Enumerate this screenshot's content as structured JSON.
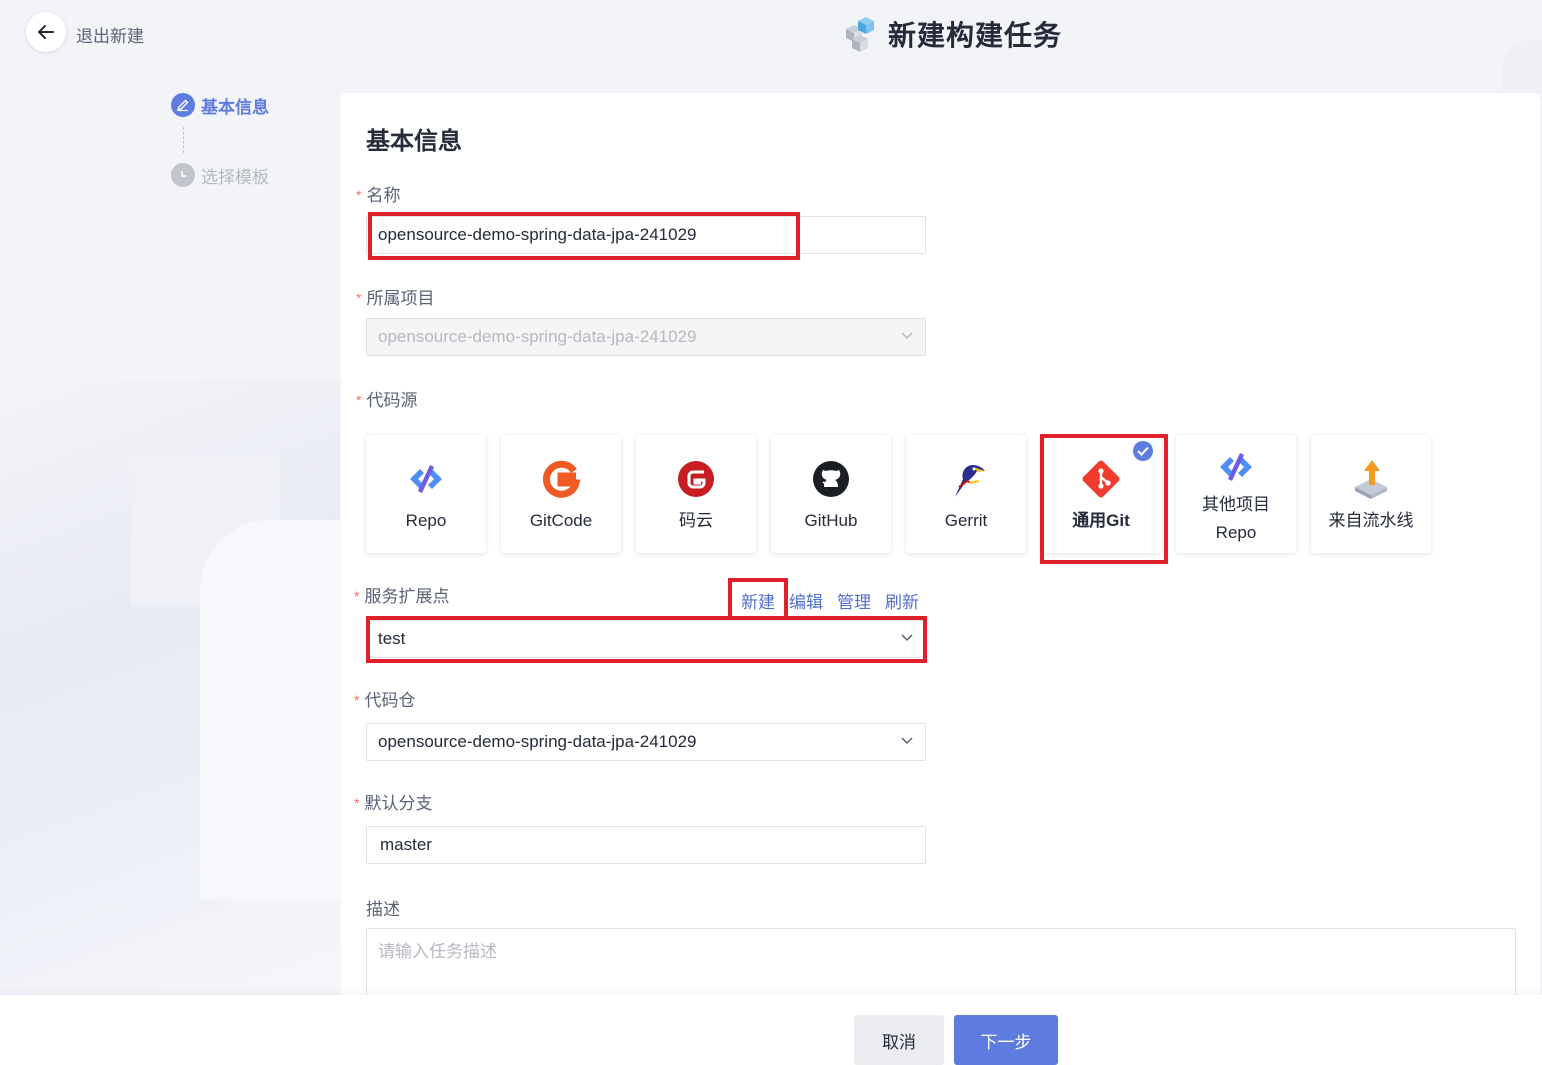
{
  "header": {
    "back_label": "退出新建",
    "page_title": "新建构建任务"
  },
  "steps": [
    {
      "label": "基本信息",
      "state": "active"
    },
    {
      "label": "选择模板",
      "state": "inactive"
    }
  ],
  "form": {
    "section_title": "基本信息",
    "name": {
      "label": "名称",
      "value": "opensource-demo-spring-data-jpa-241029"
    },
    "project": {
      "label": "所属项目",
      "value": "opensource-demo-spring-data-jpa-241029"
    },
    "code_source": {
      "label": "代码源",
      "options": [
        {
          "name": "Repo",
          "icon": "repo-icon"
        },
        {
          "name": "GitCode",
          "icon": "gitcode-icon"
        },
        {
          "name": "码云",
          "icon": "gitee-icon"
        },
        {
          "name": "GitHub",
          "icon": "github-icon"
        },
        {
          "name": "Gerrit",
          "icon": "gerrit-icon"
        },
        {
          "name": "通用Git",
          "icon": "git-icon",
          "selected": true
        },
        {
          "name": "其他项目Repo",
          "name_line1": "其他项目",
          "name_line2": "Repo",
          "icon": "repo-icon"
        },
        {
          "name": "来自流水线",
          "icon": "pipeline-icon"
        }
      ]
    },
    "endpoint": {
      "label": "服务扩展点",
      "value": "test",
      "links": {
        "new": "新建",
        "edit": "编辑",
        "manage": "管理",
        "refresh": "刷新"
      }
    },
    "repo": {
      "label": "代码仓",
      "value": "opensource-demo-spring-data-jpa-241029"
    },
    "branch": {
      "label": "默认分支",
      "value": "master"
    },
    "description": {
      "label": "描述",
      "placeholder": "请输入任务描述"
    }
  },
  "footer": {
    "cancel_label": "取消",
    "next_label": "下一步"
  },
  "colors": {
    "primary": "#5e7ce0",
    "highlight": "#e0212b",
    "required": "#f66f6a",
    "link": "#526ecc"
  }
}
